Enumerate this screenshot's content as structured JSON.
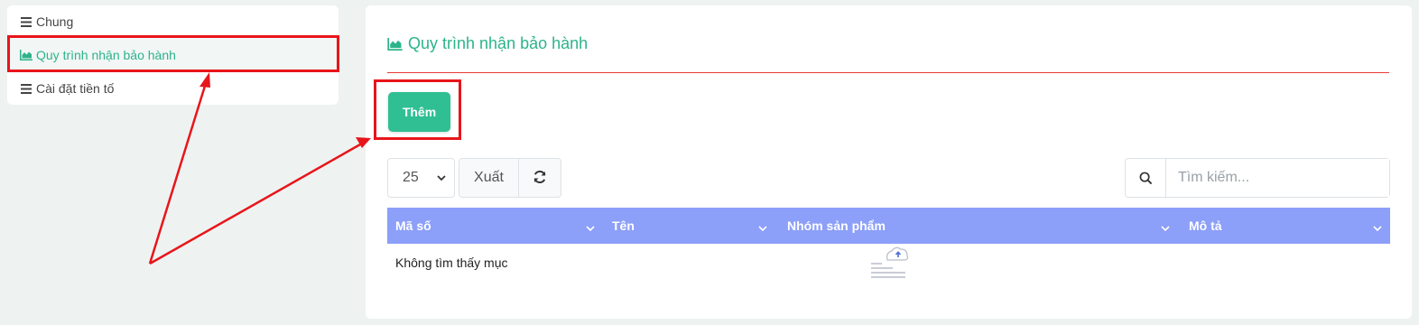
{
  "sidebar": {
    "items": [
      {
        "label": "Chung",
        "icon": "list-icon",
        "active": false
      },
      {
        "label": "Quy trình nhận bảo hành",
        "icon": "area-chart-icon",
        "active": true
      },
      {
        "label": "Cài đặt tiền tố",
        "icon": "list-icon",
        "active": false
      }
    ]
  },
  "main": {
    "title": "Quy trình nhận bảo hành",
    "add_label": "Thêm",
    "page_size": "25",
    "export_label": "Xuất",
    "search_placeholder": "Tìm kiếm...",
    "columns": [
      "Mã số",
      "Tên",
      "Nhóm sản phẩm",
      "Mô tả"
    ],
    "empty_text": "Không tìm thấy mục"
  },
  "colors": {
    "accent": "#2db38a",
    "button": "#2fbf93",
    "table_header": "#8c9ff9",
    "annotation": "#e8151b"
  }
}
